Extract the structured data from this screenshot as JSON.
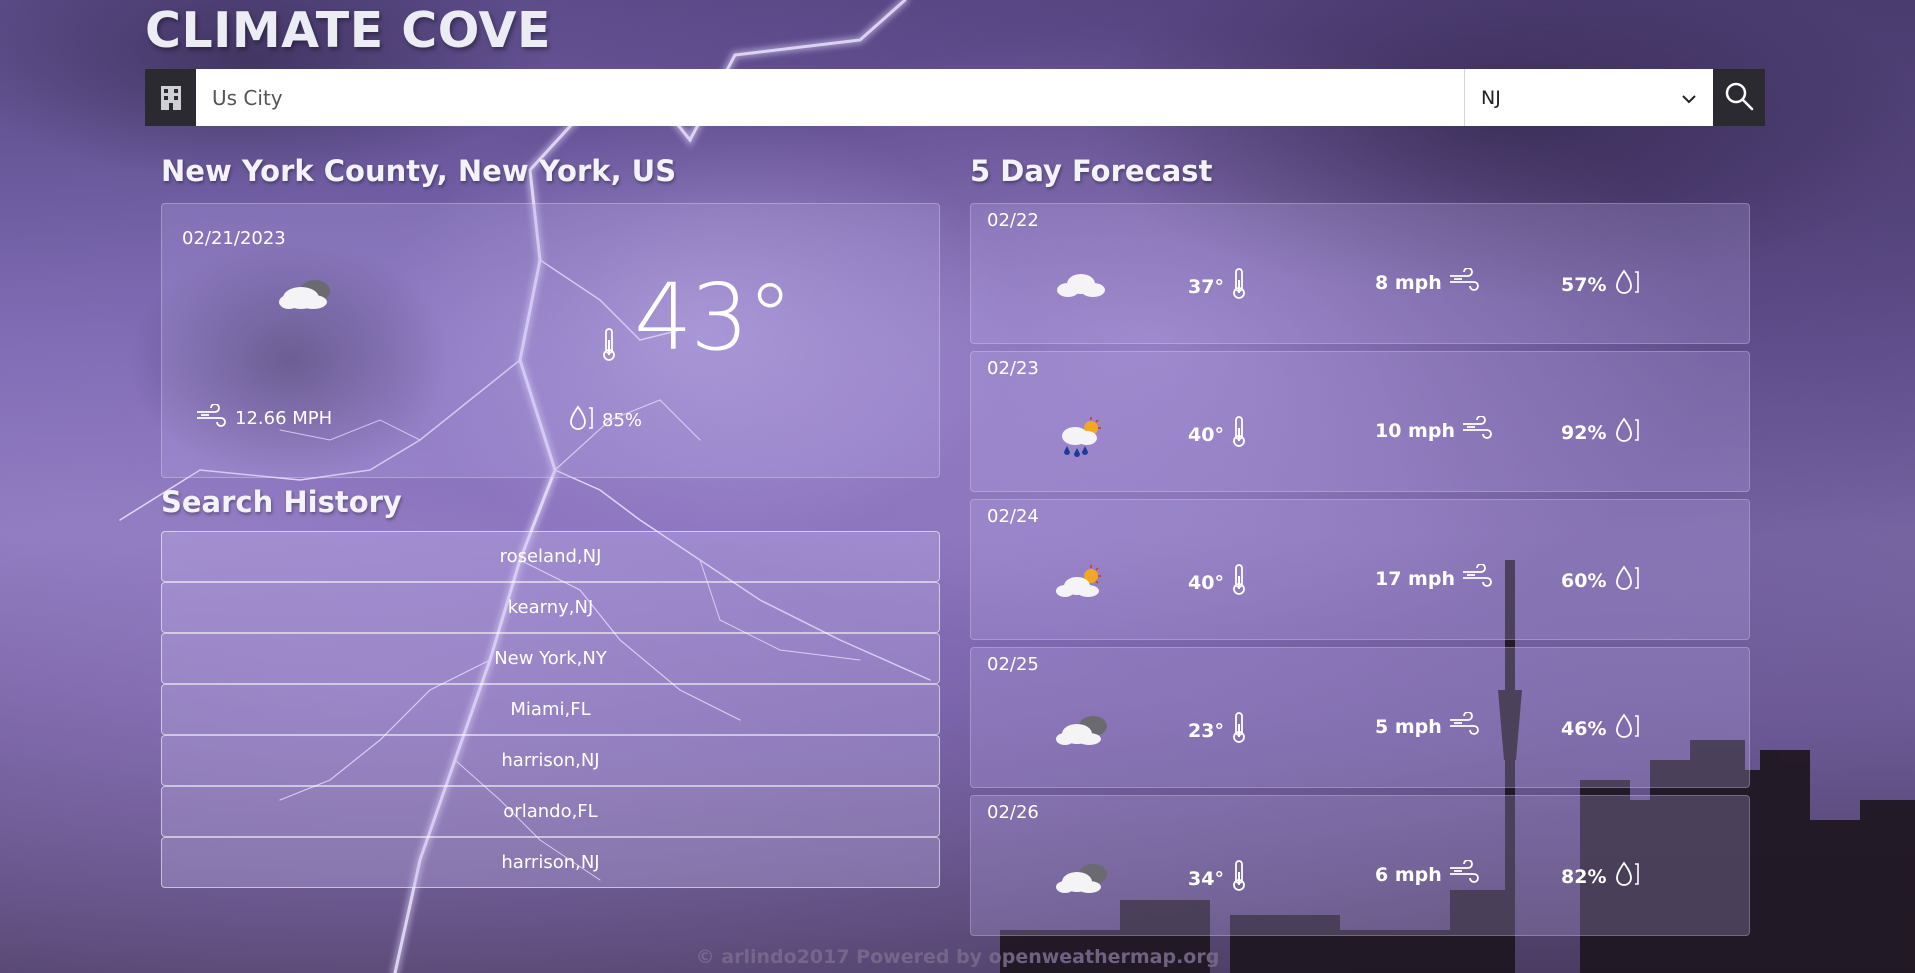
{
  "brand": "CLIMATE COVE",
  "search": {
    "placeholder": "Us City",
    "value": "",
    "state_selected": "NJ"
  },
  "current": {
    "location": "New York County, New York, US",
    "date": "02/21/2023",
    "icon": "cloudy-icon",
    "temp": "43°",
    "wind": "12.66 MPH",
    "humidity": "85%"
  },
  "history": {
    "title": "Search History",
    "items": [
      {
        "label": "roseland,NJ"
      },
      {
        "label": "kearny,NJ"
      },
      {
        "label": "New York,NY"
      },
      {
        "label": "Miami,FL"
      },
      {
        "label": "harrison,NJ"
      },
      {
        "label": "orlando,FL"
      },
      {
        "label": "harrison,NJ"
      }
    ]
  },
  "forecast": {
    "title": "5 Day Forecast",
    "days": [
      {
        "date": "02/22",
        "icon": "cloud-icon",
        "temp": "37°",
        "wind": "8 mph",
        "humidity": "57%"
      },
      {
        "date": "02/23",
        "icon": "rain-sun-icon",
        "temp": "40°",
        "wind": "10 mph",
        "humidity": "92%"
      },
      {
        "date": "02/24",
        "icon": "partly-sunny-icon",
        "temp": "40°",
        "wind": "17 mph",
        "humidity": "60%"
      },
      {
        "date": "02/25",
        "icon": "broken-clouds-icon",
        "temp": "23°",
        "wind": "5 mph",
        "humidity": "46%"
      },
      {
        "date": "02/26",
        "icon": "broken-clouds-icon",
        "temp": "34°",
        "wind": "6 mph",
        "humidity": "82%"
      }
    ]
  },
  "footer": "© arlindo2017 Powered by openweathermap.org"
}
